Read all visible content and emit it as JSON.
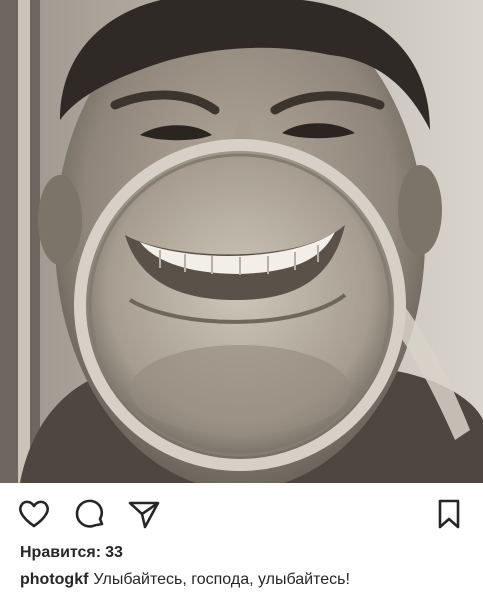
{
  "post": {
    "photo": {
      "subject": "sepia portrait of a smiling man holding a round magnifying glass over his mouth"
    },
    "actions": {
      "like_icon": "heart-outline-icon",
      "comment_icon": "comment-bubble-icon",
      "share_icon": "paper-plane-icon",
      "save_icon": "bookmark-outline-icon"
    },
    "likes": {
      "label": "Нравится:",
      "count": "33"
    },
    "caption": {
      "username": "photogkf",
      "text": "Улыбайтесь, господа, улыбайтесь!"
    }
  }
}
